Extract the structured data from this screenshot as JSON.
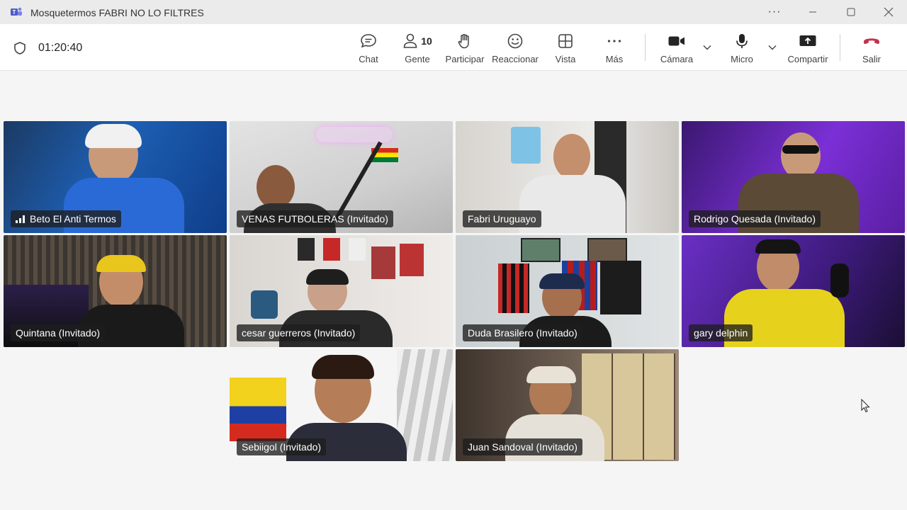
{
  "window": {
    "title": "Mosquetermos FABRI NO LO FILTRES",
    "more": "···"
  },
  "meeting": {
    "duration": "01:20:40",
    "people_count": "10"
  },
  "toolbar": {
    "chat": "Chat",
    "people": "Gente",
    "raise_hand": "Participar",
    "react": "Reaccionar",
    "view": "Vista",
    "more": "Más",
    "camera": "Cámara",
    "mic": "Micro",
    "share": "Compartir",
    "leave": "Salir"
  },
  "colors": {
    "leave_red": "#c4314b",
    "speaker_outline": "#7f85f5"
  },
  "participants": [
    {
      "name": "Beto El Anti Termos",
      "signal_icon": "signal-bars-icon"
    },
    {
      "name": "VENAS FUTBOLERAS (Invitado)"
    },
    {
      "name": "Fabri Uruguayo"
    },
    {
      "name": "Rodrigo Quesada (Invitado)",
      "speaking": true
    },
    {
      "name": "Quintana (Invitado)"
    },
    {
      "name": "cesar guerreros (Invitado)"
    },
    {
      "name": "Duda Brasilero (Invitado)"
    },
    {
      "name": "gary delphin",
      "speaking": true
    },
    {
      "name": "Sebiigol (Invitado)"
    },
    {
      "name": "Juan Sandoval (Invitado)"
    }
  ]
}
